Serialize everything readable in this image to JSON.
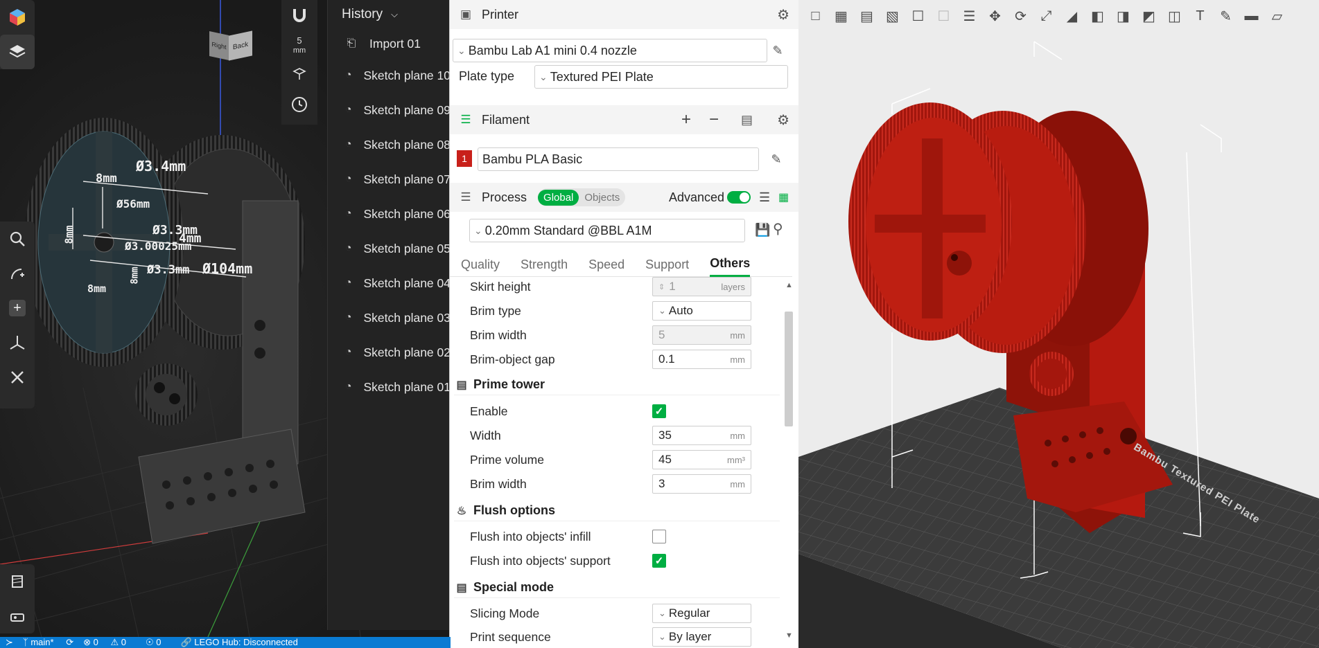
{
  "cad": {
    "snap": {
      "value": "5",
      "unit": "mm"
    },
    "viewcube": {
      "left_face": "Right",
      "right_face": "Back"
    },
    "dimensions": [
      "Ø3.4mm",
      "8mm",
      "Ø56mm",
      "Ø3.3mm",
      "Ø3.00025mm",
      "4mm",
      "Ø3.3mm",
      "Ø104mm",
      "8mm",
      "8mm",
      "8mm"
    ],
    "history": {
      "title": "History",
      "items": [
        "Import 01",
        "Sketch plane 10",
        "Sketch plane 09",
        "Sketch plane 08",
        "Sketch plane 07",
        "Sketch plane 06",
        "Sketch plane 05",
        "Sketch plane 04",
        "Sketch plane 03",
        "Sketch plane 02",
        "Sketch plane 01"
      ]
    }
  },
  "panel": {
    "printer": {
      "title": "Printer",
      "preset": "Bambu Lab A1 mini 0.4 nozzle",
      "plate_label": "Plate type",
      "plate_value": "Textured PEI Plate"
    },
    "filament": {
      "title": "Filament",
      "index": "1",
      "name": "Bambu PLA Basic",
      "color": "#c8201a"
    },
    "process": {
      "title": "Process",
      "toggle_global": "Global",
      "toggle_objects": "Objects",
      "advanced_label": "Advanced",
      "preset": "0.20mm Standard @BBL A1M",
      "tabs": [
        "Quality",
        "Strength",
        "Speed",
        "Support",
        "Others"
      ],
      "active_tab": "Others"
    },
    "settings": {
      "skirt_height": {
        "label": "Skirt height",
        "value": "1",
        "unit": "layers"
      },
      "brim_type": {
        "label": "Brim type",
        "value": "Auto"
      },
      "brim_width": {
        "label": "Brim width",
        "value": "5",
        "unit": "mm"
      },
      "brim_gap": {
        "label": "Brim-object gap",
        "value": "0.1",
        "unit": "mm"
      },
      "prime_tower": {
        "title": "Prime tower",
        "enable": {
          "label": "Enable",
          "checked": true
        },
        "width": {
          "label": "Width",
          "value": "35",
          "unit": "mm"
        },
        "prime_volume": {
          "label": "Prime volume",
          "value": "45",
          "unit": "mm³"
        },
        "brim_width": {
          "label": "Brim width",
          "value": "3",
          "unit": "mm"
        }
      },
      "flush": {
        "title": "Flush options",
        "infill": {
          "label": "Flush into objects' infill",
          "checked": false
        },
        "support": {
          "label": "Flush into objects' support",
          "checked": true
        }
      },
      "special": {
        "title": "Special mode",
        "slicing_mode": {
          "label": "Slicing Mode",
          "value": "Regular"
        },
        "print_sequence": {
          "label": "Print sequence",
          "value": "By layer"
        }
      }
    }
  },
  "preview": {
    "plate_label": "Bambu Textured PEI Plate",
    "accent": "#b5190f"
  },
  "status": {
    "branch": "main*",
    "errors": "0",
    "warnings": "0",
    "ports": "0",
    "hub": "LEGO Hub: Disconnected"
  }
}
